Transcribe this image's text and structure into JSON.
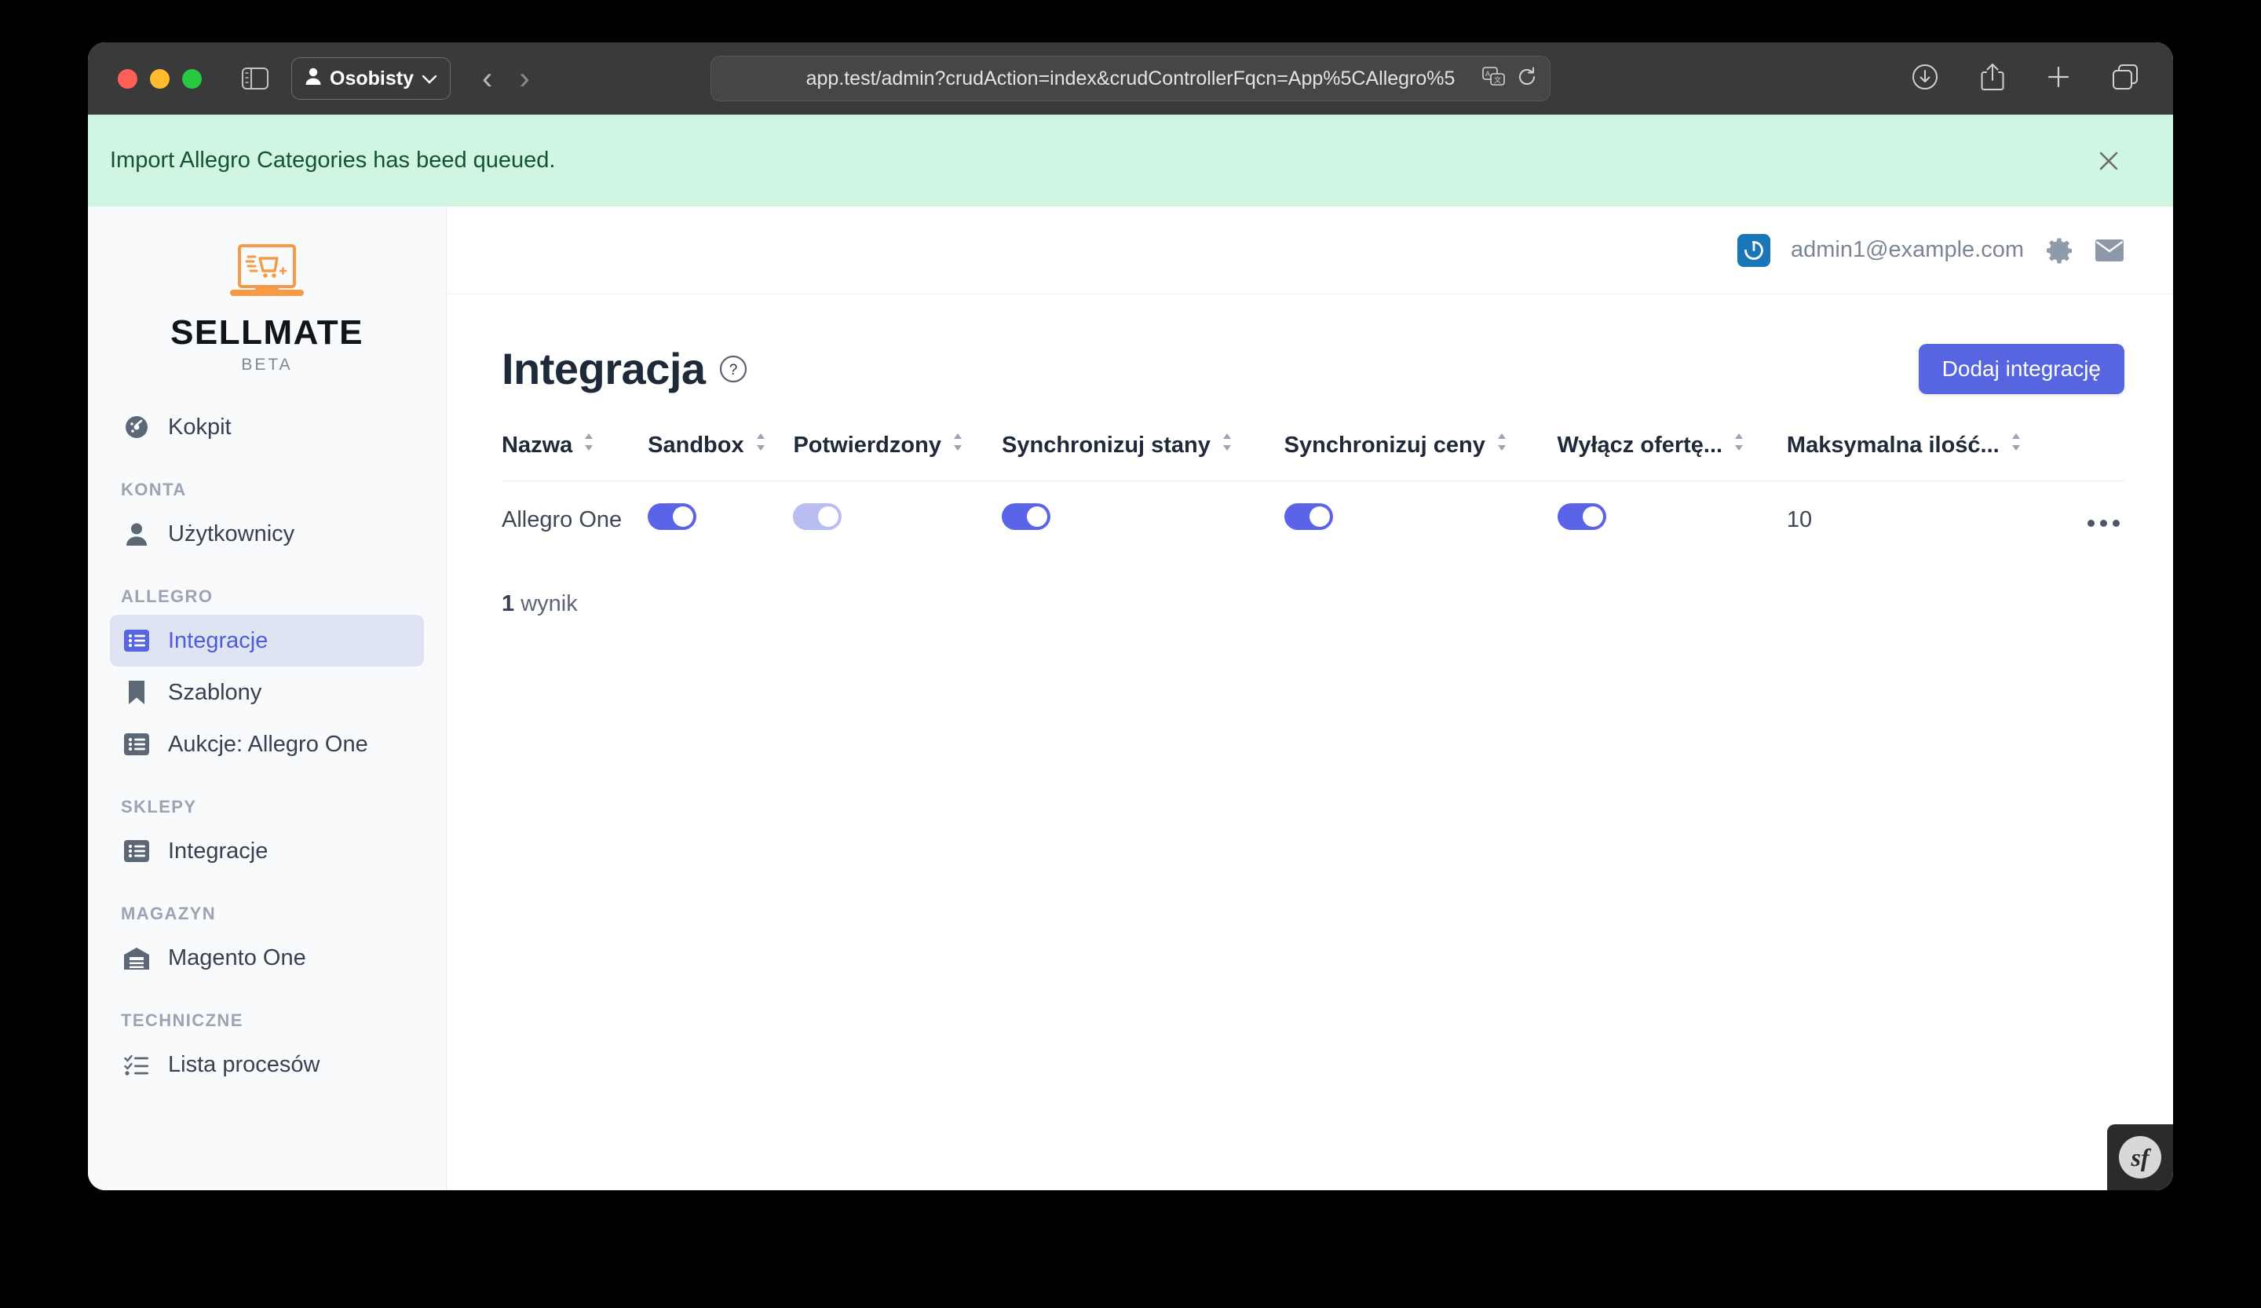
{
  "browser": {
    "profile_label": "Osobisty",
    "url": "app.test/admin?crudAction=index&crudControllerFqcn=App%5CAllegro%5",
    "back_glyph": "‹",
    "forward_glyph": "›",
    "chevron_glyph": "⌄",
    "icons": {
      "sidebar": "sidebar-toggle-icon",
      "person": "person-icon",
      "translate": "translate-icon",
      "reload": "reload-icon",
      "download": "download-icon",
      "share": "share-icon",
      "new_tab": "plus-icon",
      "tab_overview": "tab-overview-icon"
    }
  },
  "flash": {
    "message": "Import Allegro Categories has beed queued.",
    "close_label": "✕",
    "bg": "#d1f5e3",
    "fg": "#14532d"
  },
  "sidebar": {
    "logo": {
      "name": "SELLMATE",
      "beta": "BETA",
      "accent": "#f79a45"
    },
    "groups": [
      {
        "section": null,
        "items": [
          {
            "label": "Kokpit",
            "icon": "dashboard-icon",
            "active": false
          }
        ]
      },
      {
        "section": "KONTA",
        "items": [
          {
            "label": "Użytkownicy",
            "icon": "user-icon",
            "active": false
          }
        ]
      },
      {
        "section": "ALLEGRO",
        "items": [
          {
            "label": "Integracje",
            "icon": "list-icon",
            "active": true
          },
          {
            "label": "Szablony",
            "icon": "bookmark-icon",
            "active": false
          },
          {
            "label": "Aukcje: Allegro One",
            "icon": "list-icon",
            "active": false
          }
        ]
      },
      {
        "section": "SKLEPY",
        "items": [
          {
            "label": "Integracje",
            "icon": "list-icon",
            "active": false
          }
        ]
      },
      {
        "section": "MAGAZYN",
        "items": [
          {
            "label": "Magento One",
            "icon": "warehouse-icon",
            "active": false
          }
        ]
      },
      {
        "section": "TECHNICZNE",
        "items": [
          {
            "label": "Lista procesów",
            "icon": "checklist-icon",
            "active": false
          }
        ]
      }
    ]
  },
  "topbar": {
    "user_email": "admin1@example.com",
    "power_icon": "power-icon",
    "gear_icon": "gear-icon",
    "mail_icon": "envelope-icon",
    "power_bg": "#1976b8"
  },
  "page": {
    "title": "Integracja",
    "help_icon": "help-circle-icon",
    "add_button": "Dodaj integrację",
    "accent": "#5865e0"
  },
  "table": {
    "columns": [
      {
        "label": "Nazwa",
        "sortable": true,
        "align": "left"
      },
      {
        "label": "Sandbox",
        "sortable": true,
        "align": "left"
      },
      {
        "label": "Potwierdzony",
        "sortable": true,
        "align": "left"
      },
      {
        "label": "Synchronizuj stany",
        "sortable": true,
        "align": "left"
      },
      {
        "label": "Synchronizuj ceny",
        "sortable": true,
        "align": "left"
      },
      {
        "label": "Wyłącz ofertę...",
        "sortable": true,
        "align": "left"
      },
      {
        "label": "Maksymalna ilość...",
        "sortable": true,
        "align": "left"
      }
    ],
    "rows": [
      {
        "name": "Allegro One",
        "sandbox": {
          "type": "toggle",
          "on": true,
          "pale": false
        },
        "potwierdzony": {
          "type": "toggle",
          "on": true,
          "pale": true
        },
        "synchronizuj_stany": {
          "type": "toggle",
          "on": true,
          "pale": false
        },
        "synchronizuj_ceny": {
          "type": "toggle",
          "on": true,
          "pale": false
        },
        "wylacz_oferte": {
          "type": "toggle",
          "on": true,
          "pale": false
        },
        "maksymalna_ilosc": "10",
        "actions_icon": "ellipsis-icon"
      }
    ],
    "result_count_number": "1",
    "result_count_label": " wynik",
    "toggle_on_color": "#5b63e8",
    "toggle_pale_color": "#b9bdf0"
  },
  "symfony": {
    "label": "sf"
  }
}
